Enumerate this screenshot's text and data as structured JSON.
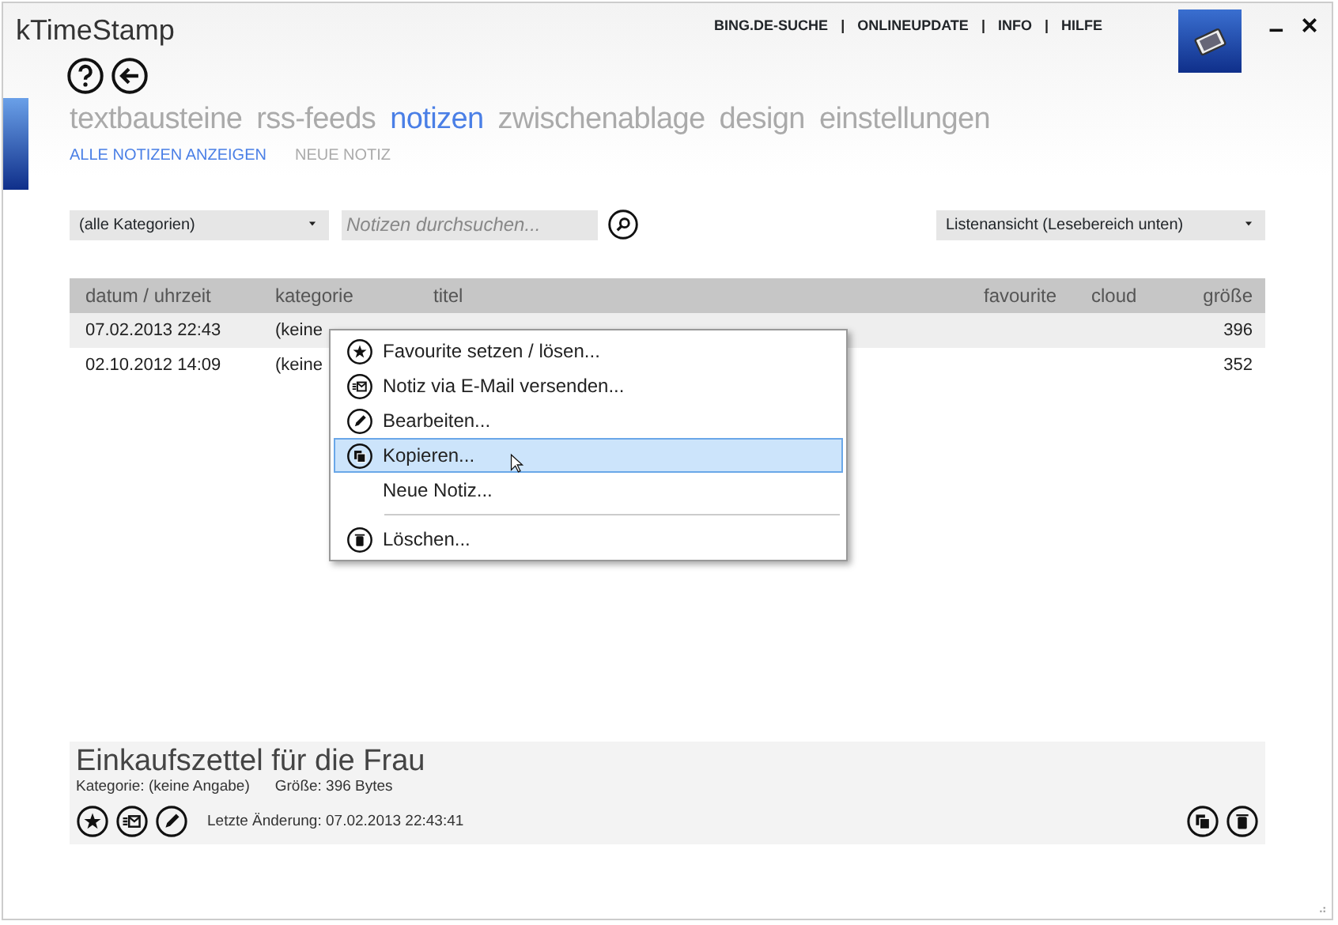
{
  "window": {
    "title": "kTimeStamp"
  },
  "top_links": [
    {
      "kind": "link",
      "label": "BING.DE-SUCHE"
    },
    {
      "kind": "separator",
      "label": "|"
    },
    {
      "kind": "link",
      "label": "ONLINEUPDATE"
    },
    {
      "kind": "separator",
      "label": "|"
    },
    {
      "kind": "link",
      "label": "INFO"
    },
    {
      "kind": "separator",
      "label": "|"
    },
    {
      "kind": "link",
      "label": "HILFE"
    }
  ],
  "nav_tabs": [
    {
      "label": "textbausteine",
      "selected": false
    },
    {
      "label": "rss-feeds",
      "selected": false
    },
    {
      "label": "notizen",
      "selected": true
    },
    {
      "label": "zwischenablage",
      "selected": false
    },
    {
      "label": "design",
      "selected": false
    },
    {
      "label": "einstellungen",
      "selected": false
    }
  ],
  "sub_tabs": [
    {
      "label": "ALLE NOTIZEN ANZEIGEN",
      "selected": true
    },
    {
      "label": "NEUE NOTIZ",
      "selected": false
    }
  ],
  "category_filter": {
    "value": "(alle Kategorien)"
  },
  "search": {
    "placeholder": "Notizen durchsuchen..."
  },
  "view_select": {
    "value": "Listenansicht (Lesebereich unten)"
  },
  "table": {
    "columns": [
      "datum / uhrzeit",
      "kategorie",
      "titel",
      "favourite",
      "cloud",
      "größe"
    ],
    "rows": [
      {
        "date": "07.02.2013 22:43",
        "category": "(keine",
        "size": "396",
        "selected": true
      },
      {
        "date": "02.10.2012 14:09",
        "category": "(keine",
        "size": "352",
        "selected": false
      }
    ]
  },
  "context_menu": [
    {
      "label": "Favourite setzen / lösen...",
      "kind": "star",
      "selected": false
    },
    {
      "label": "Notiz via E-Mail versenden...",
      "kind": "mail",
      "selected": false
    },
    {
      "label": "Bearbeiten...",
      "kind": "pencil",
      "selected": false
    },
    {
      "label": "Kopieren...",
      "kind": "copy",
      "selected": true
    },
    {
      "label": "Neue Notiz...",
      "kind": "plain",
      "selected": false
    },
    {
      "kind": "separator"
    },
    {
      "label": "Löschen...",
      "kind": "trash",
      "selected": false
    }
  ],
  "preview": {
    "title": "Einkaufszettel für die Frau",
    "category": "Kategorie: (keine Angabe)",
    "size": "Größe: 396 Bytes",
    "modified": "Letzte Änderung: 07.02.2013 22:43:41"
  }
}
